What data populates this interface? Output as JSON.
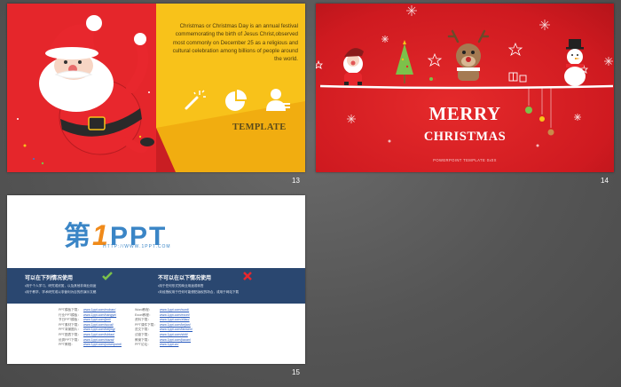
{
  "slides": [
    {
      "number": "13",
      "paragraph": "Christmas or Christmas Day is an annual festival commemorating the birth of Jesus Christ,observed most commonly on December 25 as a religious and cultural celebration among billions of people around the world.",
      "template_label": "TEMPLATE",
      "icons": [
        "magic-wand-icon",
        "pie-chart-icon",
        "user-icon"
      ],
      "colors": {
        "red": "#e5262b",
        "yellow": "#f8c21a"
      }
    },
    {
      "number": "14",
      "title_line1": "MERRY",
      "title_line2": "CHRISTMAS",
      "subtitle": "POWERPOINT TEMPLATE 0x0X",
      "colors": {
        "red": "#d61f24"
      }
    },
    {
      "number": "15",
      "logo_text": "第1PPT",
      "logo_url": "HTTP://WWW.1PPT.COM",
      "col1_title": "可以在下列情况使用",
      "col1_lines": [
        "•用于个人学习、研究或欣赏，以及其他非商业用途",
        "•用于教学、学术研究或以非营利为目的的演示文稿"
      ],
      "col2_title": "不可以在以下情况使用",
      "col2_lines": [
        "•用于任何形式的商业用途或转售",
        "•未经授权用于任何可能侵犯版权的场合，或用于网站下载"
      ],
      "list_left": [
        [
          "PPT模板下载：",
          "www.1ppt.com/moban/"
        ],
        [
          "行业PPT模板：",
          "www.1ppt.com/hangye/"
        ],
        [
          "节日PPT模板：",
          "www.1ppt.com/jieri/"
        ],
        [
          "PPT素材下载：",
          "www.1ppt.com/sucai/"
        ],
        [
          "PPT背景图片：",
          "www.1ppt.com/beijing/"
        ],
        [
          "PPT图表下载：",
          "www.1ppt.com/tubiao/"
        ],
        [
          "优秀PPT下载：",
          "www.1ppt.com/xiazai/"
        ],
        [
          "PPT教程：",
          "www.1ppt.com/powerpoint/"
        ]
      ],
      "list_right": [
        [
          "Word教程：",
          "www.1ppt.com/word/"
        ],
        [
          "Excel教程：",
          "www.1ppt.com/excel/"
        ],
        [
          "资料下载：",
          "www.1ppt.com/ziliao/"
        ],
        [
          "PPT课件下载：",
          "www.1ppt.com/kejian/"
        ],
        [
          "范文下载：",
          "www.1ppt.com/fanwen/"
        ],
        [
          "试卷下载：",
          "www.1ppt.com/shiti/"
        ],
        [
          "教案下载：",
          "www.1ppt.com/jiaoan/"
        ],
        [
          "PPT论坛：",
          "www.1ppt.cn/"
        ]
      ]
    }
  ]
}
